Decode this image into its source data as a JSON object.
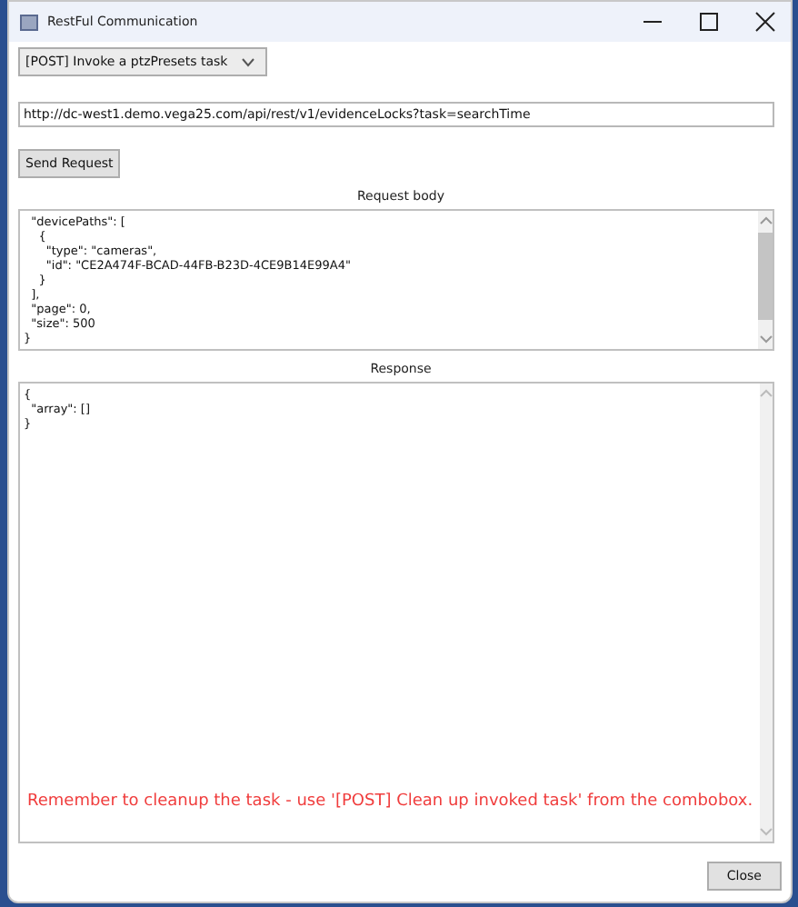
{
  "window": {
    "title": "RestFul Communication"
  },
  "task_combo": {
    "value": "[POST] Invoke a ptzPresets task"
  },
  "url_field": {
    "value": "http://dc-west1.demo.vega25.com/api/rest/v1/evidenceLocks?task=searchTime"
  },
  "send_button": "Send Request",
  "request_body": {
    "label": "Request body",
    "text": "  \"devicePaths\": [\n    {\n      \"type\": \"cameras\",\n      \"id\": \"CE2A474F-BCAD-44FB-B23D-4CE9B14E99A4\"\n    }\n  ],\n  \"page\": 0,\n  \"size\": 500\n}"
  },
  "response": {
    "label": "Response",
    "text": "{\n  \"array\": []\n}",
    "note": "Remember to cleanup the task - use '[POST] Clean up invoked task' from the combobox."
  },
  "close_button": "Close"
}
